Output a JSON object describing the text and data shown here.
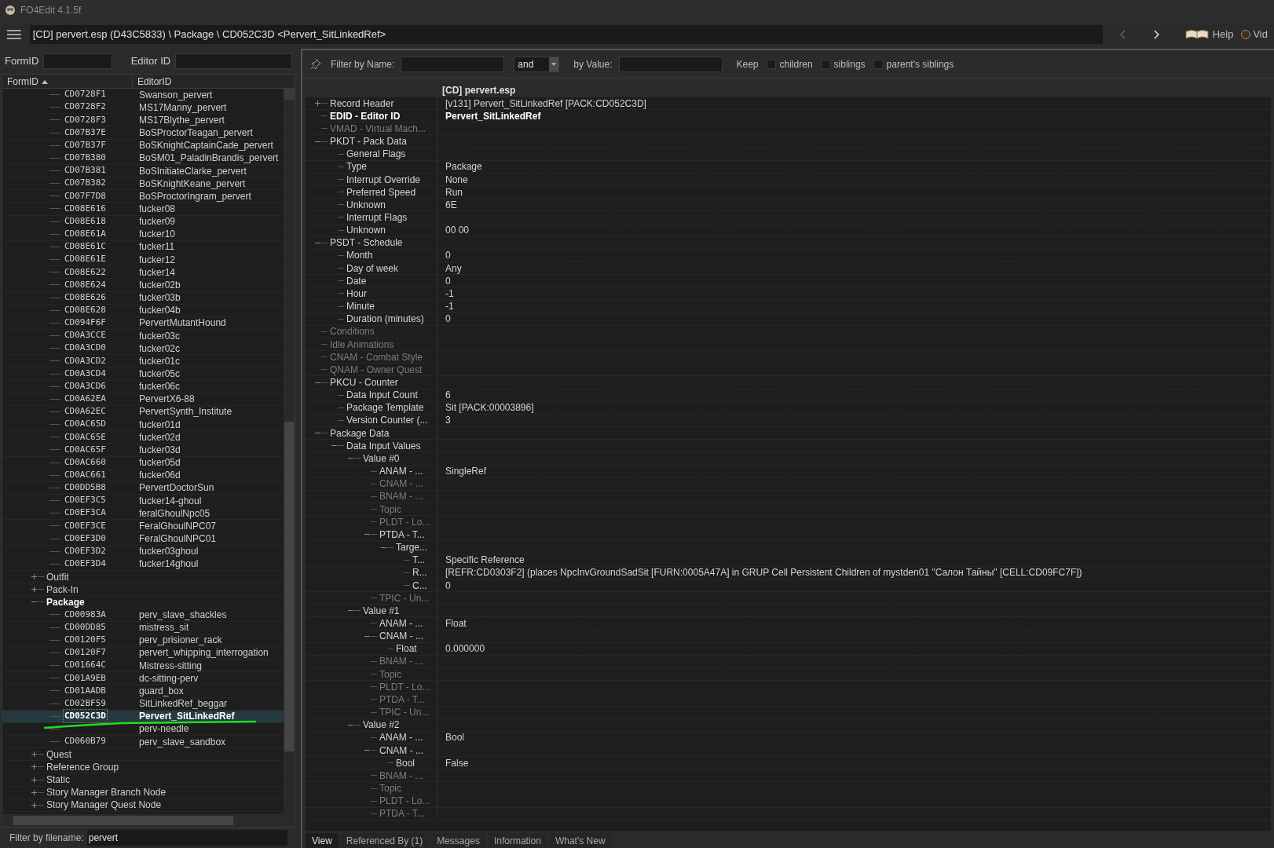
{
  "window": {
    "title": "FO4Edit 4.1.5f"
  },
  "toolbar": {
    "path": "[CD] pervert.esp (D43C5833) \\ Package \\ CD052C3D <Pervert_SitLinkedRef>",
    "help": "Help",
    "video": "Vid"
  },
  "search": {
    "form_id_label": "FormID",
    "editor_id_label": "Editor ID"
  },
  "record_list": {
    "columns": [
      "FormID",
      "EditorID"
    ],
    "items": [
      {
        "kind": "record",
        "form_id": "CD0728F1",
        "editor_id": "Swanson_pervert",
        "selected": false
      },
      {
        "kind": "record",
        "form_id": "CD0728F2",
        "editor_id": "MS17Manny_pervert",
        "selected": false
      },
      {
        "kind": "record",
        "form_id": "CD0728F3",
        "editor_id": "MS17Blythe_pervert",
        "selected": false
      },
      {
        "kind": "record",
        "form_id": "CD07B37E",
        "editor_id": "BoSProctorTeagan_pervert",
        "selected": false
      },
      {
        "kind": "record",
        "form_id": "CD07B37F",
        "editor_id": "BoSKnightCaptainCade_pervert",
        "selected": false
      },
      {
        "kind": "record",
        "form_id": "CD07B380",
        "editor_id": "BoSM01_PaladinBrandis_pervert",
        "selected": false
      },
      {
        "kind": "record",
        "form_id": "CD07B381",
        "editor_id": "BoSInitiateClarke_pervert",
        "selected": false
      },
      {
        "kind": "record",
        "form_id": "CD07B382",
        "editor_id": "BoSKnightKeane_pervert",
        "selected": false
      },
      {
        "kind": "record",
        "form_id": "CD07F7D8",
        "editor_id": "BoSProctorIngram_pervert",
        "selected": false
      },
      {
        "kind": "record",
        "form_id": "CD08E616",
        "editor_id": "fucker08",
        "selected": false
      },
      {
        "kind": "record",
        "form_id": "CD08E618",
        "editor_id": "fucker09",
        "selected": false
      },
      {
        "kind": "record",
        "form_id": "CD08E61A",
        "editor_id": "fucker10",
        "selected": false
      },
      {
        "kind": "record",
        "form_id": "CD08E61C",
        "editor_id": "fucker11",
        "selected": false
      },
      {
        "kind": "record",
        "form_id": "CD08E61E",
        "editor_id": "fucker12",
        "selected": false
      },
      {
        "kind": "record",
        "form_id": "CD08E622",
        "editor_id": "fucker14",
        "selected": false
      },
      {
        "kind": "record",
        "form_id": "CD08E624",
        "editor_id": "fucker02b",
        "selected": false
      },
      {
        "kind": "record",
        "form_id": "CD08E626",
        "editor_id": "fucker03b",
        "selected": false
      },
      {
        "kind": "record",
        "form_id": "CD08E628",
        "editor_id": "fucker04b",
        "selected": false
      },
      {
        "kind": "record",
        "form_id": "CD094F6F",
        "editor_id": "PervertMutantHound",
        "selected": false
      },
      {
        "kind": "record",
        "form_id": "CD0A3CCE",
        "editor_id": "fucker03c",
        "selected": false
      },
      {
        "kind": "record",
        "form_id": "CD0A3CD0",
        "editor_id": "fucker02c",
        "selected": false
      },
      {
        "kind": "record",
        "form_id": "CD0A3CD2",
        "editor_id": "fucker01c",
        "selected": false
      },
      {
        "kind": "record",
        "form_id": "CD0A3CD4",
        "editor_id": "fucker05c",
        "selected": false
      },
      {
        "kind": "record",
        "form_id": "CD0A3CD6",
        "editor_id": "fucker06c",
        "selected": false
      },
      {
        "kind": "record",
        "form_id": "CD0A62EA",
        "editor_id": "PervertX6-88",
        "selected": false
      },
      {
        "kind": "record",
        "form_id": "CD0A62EC",
        "editor_id": "PervertSynth_Institute",
        "selected": false
      },
      {
        "kind": "record",
        "form_id": "CD0AC65D",
        "editor_id": "fucker01d",
        "selected": false
      },
      {
        "kind": "record",
        "form_id": "CD0AC65E",
        "editor_id": "fucker02d",
        "selected": false
      },
      {
        "kind": "record",
        "form_id": "CD0AC65F",
        "editor_id": "fucker03d",
        "selected": false
      },
      {
        "kind": "record",
        "form_id": "CD0AC660",
        "editor_id": "fucker05d",
        "selected": false
      },
      {
        "kind": "record",
        "form_id": "CD0AC661",
        "editor_id": "fucker06d",
        "selected": false
      },
      {
        "kind": "record",
        "form_id": "CD0DD5B8",
        "editor_id": "PervertDoctorSun",
        "selected": false
      },
      {
        "kind": "record",
        "form_id": "CD0EF3C5",
        "editor_id": "fucker14-ghoul",
        "selected": false
      },
      {
        "kind": "record",
        "form_id": "CD0EF3CA",
        "editor_id": "feralGhoulNpc05",
        "selected": false
      },
      {
        "kind": "record",
        "form_id": "CD0EF3CE",
        "editor_id": "FeralGhoulNPC07",
        "selected": false
      },
      {
        "kind": "record",
        "form_id": "CD0EF3D0",
        "editor_id": "FeralGhoulNPC01",
        "selected": false
      },
      {
        "kind": "record",
        "form_id": "CD0EF3D2",
        "editor_id": "fucker03ghoul",
        "selected": false
      },
      {
        "kind": "record",
        "form_id": "CD0EF3D4",
        "editor_id": "fucker14ghoul",
        "selected": false
      },
      {
        "kind": "group",
        "label": "Outfit",
        "expanded": false
      },
      {
        "kind": "group",
        "label": "Pack-In",
        "expanded": false
      },
      {
        "kind": "group",
        "label": "Package",
        "expanded": true,
        "children": [
          {
            "kind": "record",
            "form_id": "CD00983A",
            "editor_id": "perv_slave_shackles",
            "selected": false
          },
          {
            "kind": "record",
            "form_id": "CD00DD85",
            "editor_id": "mistress_sit",
            "selected": false
          },
          {
            "kind": "record",
            "form_id": "CD0120F5",
            "editor_id": "perv_prisioner_rack",
            "selected": false
          },
          {
            "kind": "record",
            "form_id": "CD0120F7",
            "editor_id": "pervert_whipping_interrogation",
            "selected": false
          },
          {
            "kind": "record",
            "form_id": "CD01664C",
            "editor_id": "Mistress-sitting",
            "selected": false
          },
          {
            "kind": "record",
            "form_id": "CD01A9EB",
            "editor_id": "dc-sitting-perv",
            "selected": false
          },
          {
            "kind": "record",
            "form_id": "CD01AADB",
            "editor_id": "guard_box",
            "selected": false
          },
          {
            "kind": "record",
            "form_id": "CD02BF59",
            "editor_id": "SitLinkedRef_beggar",
            "selected": false
          },
          {
            "kind": "record",
            "form_id": "CD052C3D",
            "editor_id": "Pervert_SitLinkedRef",
            "selected": true
          },
          {
            "kind": "record",
            "editor_id": "perv-needle",
            "selected": false
          },
          {
            "kind": "record",
            "form_id": "CD060B79",
            "editor_id": "perv_slave_sandbox",
            "selected": false
          }
        ]
      },
      {
        "kind": "group",
        "label": "Quest",
        "expanded": false
      },
      {
        "kind": "group",
        "label": "Reference Group",
        "expanded": false
      },
      {
        "kind": "group",
        "label": "Static",
        "expanded": false
      },
      {
        "kind": "group",
        "label": "Story Manager Branch Node",
        "expanded": false
      },
      {
        "kind": "group",
        "label": "Story Manager Quest Node",
        "expanded": false
      }
    ]
  },
  "file_filter": {
    "label": "Filter by filename:",
    "value": "pervert"
  },
  "filter_bar": {
    "name_label": "Filter by Name:",
    "operator": "and",
    "value_label": "by Value:",
    "keep_label": "Keep",
    "options": [
      {
        "label": "children",
        "checked": false
      },
      {
        "label": "siblings",
        "checked": false
      },
      {
        "label": "parent's siblings",
        "checked": false
      }
    ]
  },
  "record_view": {
    "column": "[CD] pervert.esp",
    "nodes": [
      {
        "label": "Record Header",
        "value": "[v131] Pervert_SitLinkedRef [PACK:CD052C3D]",
        "dimmed": false,
        "highlighted": false,
        "expanded": false
      },
      {
        "label": "EDID - Editor ID",
        "value": "Pervert_SitLinkedRef",
        "dimmed": false,
        "highlighted": true
      },
      {
        "label": "VMAD - Virtual Mach...",
        "dimmed": true,
        "highlighted": false
      },
      {
        "label": "PKDT - Pack Data",
        "dimmed": false,
        "highlighted": false,
        "expanded": true,
        "children": [
          {
            "label": "General Flags",
            "dimmed": false
          },
          {
            "label": "Type",
            "value": "Package",
            "dimmed": false
          },
          {
            "label": "Interrupt Override",
            "value": "None",
            "dimmed": false
          },
          {
            "label": "Preferred Speed",
            "value": "Run",
            "dimmed": false
          },
          {
            "label": "Unknown",
            "value": "6E",
            "dimmed": false
          },
          {
            "label": "Interrupt Flags",
            "dimmed": false
          },
          {
            "label": "Unknown",
            "value": "00 00",
            "dimmed": false
          }
        ]
      },
      {
        "label": "PSDT - Schedule",
        "dimmed": false,
        "highlighted": false,
        "expanded": true,
        "children": [
          {
            "label": "Month",
            "value": "0",
            "dimmed": false
          },
          {
            "label": "Day of week",
            "value": "Any",
            "dimmed": false
          },
          {
            "label": "Date",
            "value": "0",
            "dimmed": false
          },
          {
            "label": "Hour",
            "value": "-1",
            "dimmed": false
          },
          {
            "label": "Minute",
            "value": "-1",
            "dimmed": false
          },
          {
            "label": "Duration (minutes)",
            "value": "0",
            "dimmed": false
          }
        ]
      },
      {
        "label": "Conditions",
        "dimmed": true,
        "highlighted": false
      },
      {
        "label": "Idle Animations",
        "dimmed": true,
        "highlighted": false
      },
      {
        "label": "CNAM - Combat Style",
        "dimmed": true,
        "highlighted": false
      },
      {
        "label": "QNAM - Owner Quest",
        "dimmed": true,
        "highlighted": false
      },
      {
        "label": "PKCU - Counter",
        "dimmed": false,
        "highlighted": false,
        "expanded": true,
        "children": [
          {
            "label": "Data Input Count",
            "value": "6",
            "dimmed": false
          },
          {
            "label": "Package Template",
            "value": "Sit [PACK:00003896]",
            "dimmed": false
          },
          {
            "label": "Version Counter (...",
            "value": "3",
            "dimmed": false
          }
        ]
      },
      {
        "label": "Package Data",
        "dimmed": false,
        "highlighted": false,
        "expanded": true,
        "children": [
          {
            "label": "Data Input Values",
            "dimmed": false,
            "expanded": true,
            "children": [
              {
                "label": "Value #0",
                "dimmed": false,
                "expanded": true,
                "children": [
                  {
                    "label": "ANAM - ...",
                    "value": "SingleRef",
                    "dimmed": false
                  },
                  {
                    "label": "CNAM - ...",
                    "dimmed": true
                  },
                  {
                    "label": "BNAM - ...",
                    "dimmed": true
                  },
                  {
                    "label": "Topic",
                    "dimmed": true
                  },
                  {
                    "label": "PLDT - Lo...",
                    "dimmed": true
                  },
                  {
                    "label": "PTDA - T...",
                    "dimmed": false,
                    "expanded": true,
                    "children": [
                      {
                        "label": "Targe...",
                        "dimmed": false,
                        "expanded": true,
                        "children": [
                          {
                            "label": "T...",
                            "value": "Specific Reference",
                            "dimmed": false
                          },
                          {
                            "label": "R...",
                            "value": "[REFR:CD0303F2] (places NpcInvGroundSadSit [FURN:0005A47A] in GRUP Cell Persistent Children of mystden01 \"Салон Тайны\" [CELL:CD09FC7F])",
                            "dimmed": false
                          },
                          {
                            "label": "C...",
                            "value": "0",
                            "dimmed": false
                          }
                        ]
                      }
                    ]
                  },
                  {
                    "label": "TPIC - Un...",
                    "dimmed": true
                  }
                ]
              },
              {
                "label": "Value #1",
                "dimmed": false,
                "expanded": true,
                "children": [
                  {
                    "label": "ANAM - ...",
                    "value": "Float",
                    "dimmed": false
                  },
                  {
                    "label": "CNAM - ...",
                    "dimmed": false,
                    "expanded": true,
                    "children": [
                      {
                        "label": "Float",
                        "value": "0.000000",
                        "dimmed": false
                      }
                    ]
                  },
                  {
                    "label": "BNAM - ...",
                    "dimmed": true
                  },
                  {
                    "label": "Topic",
                    "dimmed": true
                  },
                  {
                    "label": "PLDT - Lo...",
                    "dimmed": true
                  },
                  {
                    "label": "PTDA - T...",
                    "dimmed": true
                  },
                  {
                    "label": "TPIC - Un...",
                    "dimmed": true
                  }
                ]
              },
              {
                "label": "Value #2",
                "dimmed": false,
                "expanded": true,
                "children": [
                  {
                    "label": "ANAM - ...",
                    "value": "Bool",
                    "dimmed": false
                  },
                  {
                    "label": "CNAM - ...",
                    "dimmed": false,
                    "expanded": true,
                    "children": [
                      {
                        "label": "Bool",
                        "value": "False",
                        "dimmed": false
                      }
                    ]
                  },
                  {
                    "label": "BNAM - ...",
                    "dimmed": true
                  },
                  {
                    "label": "Topic",
                    "dimmed": true
                  },
                  {
                    "label": "PLDT - Lo...",
                    "dimmed": true
                  },
                  {
                    "label": "PTDA - T...",
                    "dimmed": true
                  }
                ]
              }
            ]
          }
        ]
      }
    ]
  },
  "bottom_tabs": [
    {
      "label": "View",
      "selected": true
    },
    {
      "label": "Referenced By (1)",
      "selected": false
    },
    {
      "label": "Messages",
      "selected": false
    },
    {
      "label": "Information",
      "selected": false
    },
    {
      "label": "What's New",
      "selected": false
    }
  ]
}
